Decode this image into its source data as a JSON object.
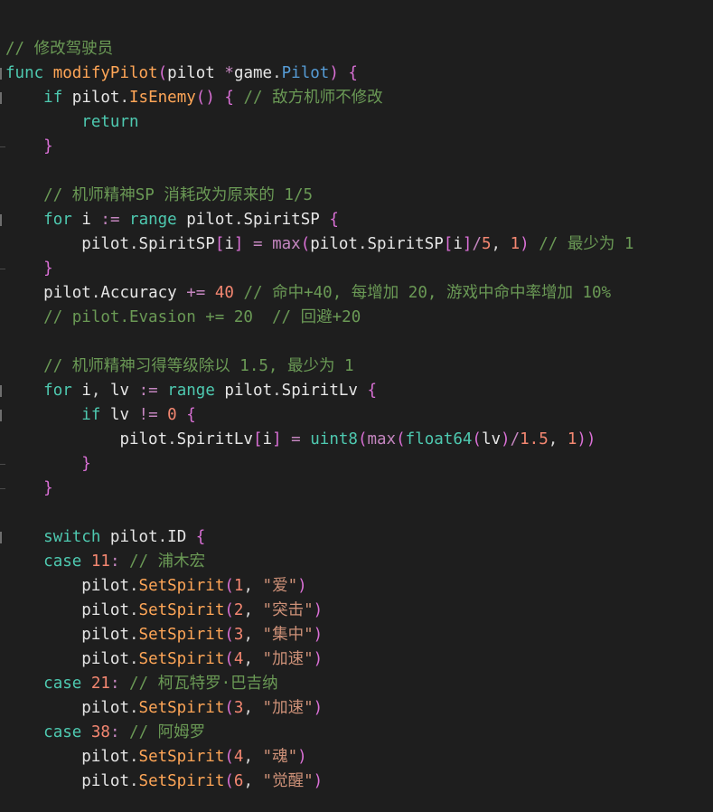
{
  "colors": {
    "background": "#1e1e1e",
    "comment": "#6a9955",
    "keyword": "#4ec9b0",
    "function_name": "#dcdcaa",
    "method": "#ffa657",
    "type": "#569cd6",
    "number": "#f48771",
    "string": "#ce9178",
    "operator": "#c586c0",
    "identifier": "#e6e6e6",
    "bracket": "#da70d6"
  },
  "code_lines": [
    {
      "fold": false,
      "tokens": [
        {
          "t": "comment",
          "v": "// 修改驾驶员"
        }
      ]
    },
    {
      "fold": true,
      "tokens": [
        {
          "t": "keyword",
          "v": "func"
        },
        {
          "t": "plain",
          "v": " "
        },
        {
          "t": "fn-orange",
          "v": "modifyPilot"
        },
        {
          "t": "paren",
          "v": "("
        },
        {
          "t": "ident",
          "v": "pilot"
        },
        {
          "t": "plain",
          "v": " "
        },
        {
          "t": "op",
          "v": "*"
        },
        {
          "t": "ident",
          "v": "game"
        },
        {
          "t": "dot",
          "v": "."
        },
        {
          "t": "type",
          "v": "Pilot"
        },
        {
          "t": "paren",
          "v": ")"
        },
        {
          "t": "plain",
          "v": " "
        },
        {
          "t": "paren",
          "v": "{"
        }
      ]
    },
    {
      "fold": true,
      "tokens": [
        {
          "t": "plain",
          "v": "    "
        },
        {
          "t": "keyword",
          "v": "if"
        },
        {
          "t": "plain",
          "v": " "
        },
        {
          "t": "ident",
          "v": "pilot"
        },
        {
          "t": "dot",
          "v": "."
        },
        {
          "t": "method",
          "v": "IsEnemy"
        },
        {
          "t": "paren",
          "v": "()"
        },
        {
          "t": "plain",
          "v": " "
        },
        {
          "t": "paren",
          "v": "{"
        },
        {
          "t": "plain",
          "v": " "
        },
        {
          "t": "comment",
          "v": "// 敌方机师不修改"
        }
      ]
    },
    {
      "fold": false,
      "tokens": [
        {
          "t": "plain",
          "v": "        "
        },
        {
          "t": "keyword",
          "v": "return"
        }
      ]
    },
    {
      "fold": false,
      "guide": true,
      "tokens": [
        {
          "t": "plain",
          "v": "    "
        },
        {
          "t": "paren",
          "v": "}"
        }
      ]
    },
    {
      "fold": false,
      "tokens": []
    },
    {
      "fold": false,
      "tokens": [
        {
          "t": "plain",
          "v": "    "
        },
        {
          "t": "comment",
          "v": "// 机师精神SP 消耗改为原来的 1/5"
        }
      ]
    },
    {
      "fold": true,
      "tokens": [
        {
          "t": "plain",
          "v": "    "
        },
        {
          "t": "keyword",
          "v": "for"
        },
        {
          "t": "plain",
          "v": " "
        },
        {
          "t": "ident",
          "v": "i"
        },
        {
          "t": "plain",
          "v": " "
        },
        {
          "t": "op",
          "v": ":="
        },
        {
          "t": "plain",
          "v": " "
        },
        {
          "t": "keyword",
          "v": "range"
        },
        {
          "t": "plain",
          "v": " "
        },
        {
          "t": "ident",
          "v": "pilot"
        },
        {
          "t": "dot",
          "v": "."
        },
        {
          "t": "ident",
          "v": "SpiritSP"
        },
        {
          "t": "plain",
          "v": " "
        },
        {
          "t": "paren",
          "v": "{"
        }
      ]
    },
    {
      "fold": false,
      "tokens": [
        {
          "t": "plain",
          "v": "        "
        },
        {
          "t": "ident",
          "v": "pilot"
        },
        {
          "t": "dot",
          "v": "."
        },
        {
          "t": "ident",
          "v": "SpiritSP"
        },
        {
          "t": "paren",
          "v": "["
        },
        {
          "t": "ident",
          "v": "i"
        },
        {
          "t": "paren",
          "v": "]"
        },
        {
          "t": "plain",
          "v": " "
        },
        {
          "t": "op",
          "v": "="
        },
        {
          "t": "plain",
          "v": " "
        },
        {
          "t": "builtin",
          "v": "max"
        },
        {
          "t": "paren",
          "v": "("
        },
        {
          "t": "ident",
          "v": "pilot"
        },
        {
          "t": "dot",
          "v": "."
        },
        {
          "t": "ident",
          "v": "SpiritSP"
        },
        {
          "t": "paren",
          "v": "["
        },
        {
          "t": "ident",
          "v": "i"
        },
        {
          "t": "paren",
          "v": "]"
        },
        {
          "t": "op",
          "v": "/"
        },
        {
          "t": "number",
          "v": "5"
        },
        {
          "t": "plain",
          "v": ", "
        },
        {
          "t": "number",
          "v": "1"
        },
        {
          "t": "paren",
          "v": ")"
        },
        {
          "t": "plain",
          "v": " "
        },
        {
          "t": "comment",
          "v": "// 最少为 1"
        }
      ]
    },
    {
      "fold": false,
      "guide": true,
      "tokens": [
        {
          "t": "plain",
          "v": "    "
        },
        {
          "t": "paren",
          "v": "}"
        }
      ]
    },
    {
      "fold": false,
      "tokens": [
        {
          "t": "plain",
          "v": "    "
        },
        {
          "t": "ident",
          "v": "pilot"
        },
        {
          "t": "dot",
          "v": "."
        },
        {
          "t": "ident",
          "v": "Accuracy"
        },
        {
          "t": "plain",
          "v": " "
        },
        {
          "t": "op",
          "v": "+="
        },
        {
          "t": "plain",
          "v": " "
        },
        {
          "t": "number",
          "v": "40"
        },
        {
          "t": "plain",
          "v": " "
        },
        {
          "t": "comment",
          "v": "// 命中+40, 每增加 20, 游戏中命中率增加 10%"
        }
      ]
    },
    {
      "fold": false,
      "tokens": [
        {
          "t": "plain",
          "v": "    "
        },
        {
          "t": "comment",
          "v": "// pilot.Evasion += 20  // 回避+20"
        }
      ]
    },
    {
      "fold": false,
      "tokens": []
    },
    {
      "fold": false,
      "tokens": [
        {
          "t": "plain",
          "v": "    "
        },
        {
          "t": "comment",
          "v": "// 机师精神习得等级除以 1.5, 最少为 1"
        }
      ]
    },
    {
      "fold": true,
      "tokens": [
        {
          "t": "plain",
          "v": "    "
        },
        {
          "t": "keyword",
          "v": "for"
        },
        {
          "t": "plain",
          "v": " "
        },
        {
          "t": "ident",
          "v": "i"
        },
        {
          "t": "plain",
          "v": ", "
        },
        {
          "t": "ident",
          "v": "lv"
        },
        {
          "t": "plain",
          "v": " "
        },
        {
          "t": "op",
          "v": ":="
        },
        {
          "t": "plain",
          "v": " "
        },
        {
          "t": "keyword",
          "v": "range"
        },
        {
          "t": "plain",
          "v": " "
        },
        {
          "t": "ident",
          "v": "pilot"
        },
        {
          "t": "dot",
          "v": "."
        },
        {
          "t": "ident",
          "v": "SpiritLv"
        },
        {
          "t": "plain",
          "v": " "
        },
        {
          "t": "paren",
          "v": "{"
        }
      ]
    },
    {
      "fold": true,
      "tokens": [
        {
          "t": "plain",
          "v": "        "
        },
        {
          "t": "keyword",
          "v": "if"
        },
        {
          "t": "plain",
          "v": " "
        },
        {
          "t": "ident",
          "v": "lv"
        },
        {
          "t": "plain",
          "v": " "
        },
        {
          "t": "op",
          "v": "!="
        },
        {
          "t": "plain",
          "v": " "
        },
        {
          "t": "number",
          "v": "0"
        },
        {
          "t": "plain",
          "v": " "
        },
        {
          "t": "paren",
          "v": "{"
        }
      ]
    },
    {
      "fold": false,
      "tokens": [
        {
          "t": "plain",
          "v": "            "
        },
        {
          "t": "ident",
          "v": "pilot"
        },
        {
          "t": "dot",
          "v": "."
        },
        {
          "t": "ident",
          "v": "SpiritLv"
        },
        {
          "t": "paren",
          "v": "["
        },
        {
          "t": "ident",
          "v": "i"
        },
        {
          "t": "paren",
          "v": "]"
        },
        {
          "t": "plain",
          "v": " "
        },
        {
          "t": "op",
          "v": "="
        },
        {
          "t": "plain",
          "v": " "
        },
        {
          "t": "keyword",
          "v": "uint8"
        },
        {
          "t": "paren",
          "v": "("
        },
        {
          "t": "builtin",
          "v": "max"
        },
        {
          "t": "paren",
          "v": "("
        },
        {
          "t": "keyword",
          "v": "float64"
        },
        {
          "t": "paren",
          "v": "("
        },
        {
          "t": "ident",
          "v": "lv"
        },
        {
          "t": "paren",
          "v": ")"
        },
        {
          "t": "op",
          "v": "/"
        },
        {
          "t": "number",
          "v": "1.5"
        },
        {
          "t": "plain",
          "v": ", "
        },
        {
          "t": "number",
          "v": "1"
        },
        {
          "t": "paren",
          "v": "))"
        }
      ]
    },
    {
      "fold": false,
      "guide": true,
      "tokens": [
        {
          "t": "plain",
          "v": "        "
        },
        {
          "t": "paren",
          "v": "}"
        }
      ]
    },
    {
      "fold": false,
      "guide": true,
      "tokens": [
        {
          "t": "plain",
          "v": "    "
        },
        {
          "t": "paren",
          "v": "}"
        }
      ]
    },
    {
      "fold": false,
      "tokens": []
    },
    {
      "fold": true,
      "tokens": [
        {
          "t": "plain",
          "v": "    "
        },
        {
          "t": "keyword",
          "v": "switch"
        },
        {
          "t": "plain",
          "v": " "
        },
        {
          "t": "ident",
          "v": "pilot"
        },
        {
          "t": "dot",
          "v": "."
        },
        {
          "t": "ident",
          "v": "ID"
        },
        {
          "t": "plain",
          "v": " "
        },
        {
          "t": "paren",
          "v": "{"
        }
      ]
    },
    {
      "fold": false,
      "tokens": [
        {
          "t": "plain",
          "v": "    "
        },
        {
          "t": "keyword",
          "v": "case"
        },
        {
          "t": "plain",
          "v": " "
        },
        {
          "t": "number",
          "v": "11"
        },
        {
          "t": "op",
          "v": ":"
        },
        {
          "t": "plain",
          "v": " "
        },
        {
          "t": "comment",
          "v": "// 浦木宏"
        }
      ]
    },
    {
      "fold": false,
      "tokens": [
        {
          "t": "plain",
          "v": "        "
        },
        {
          "t": "ident",
          "v": "pilot"
        },
        {
          "t": "dot",
          "v": "."
        },
        {
          "t": "method",
          "v": "SetSpirit"
        },
        {
          "t": "paren",
          "v": "("
        },
        {
          "t": "number",
          "v": "1"
        },
        {
          "t": "plain",
          "v": ", "
        },
        {
          "t": "string",
          "v": "\"爱\""
        },
        {
          "t": "paren",
          "v": ")"
        }
      ]
    },
    {
      "fold": false,
      "tokens": [
        {
          "t": "plain",
          "v": "        "
        },
        {
          "t": "ident",
          "v": "pilot"
        },
        {
          "t": "dot",
          "v": "."
        },
        {
          "t": "method",
          "v": "SetSpirit"
        },
        {
          "t": "paren",
          "v": "("
        },
        {
          "t": "number",
          "v": "2"
        },
        {
          "t": "plain",
          "v": ", "
        },
        {
          "t": "string",
          "v": "\"突击\""
        },
        {
          "t": "paren",
          "v": ")"
        }
      ]
    },
    {
      "fold": false,
      "tokens": [
        {
          "t": "plain",
          "v": "        "
        },
        {
          "t": "ident",
          "v": "pilot"
        },
        {
          "t": "dot",
          "v": "."
        },
        {
          "t": "method",
          "v": "SetSpirit"
        },
        {
          "t": "paren",
          "v": "("
        },
        {
          "t": "number",
          "v": "3"
        },
        {
          "t": "plain",
          "v": ", "
        },
        {
          "t": "string",
          "v": "\"集中\""
        },
        {
          "t": "paren",
          "v": ")"
        }
      ]
    },
    {
      "fold": false,
      "tokens": [
        {
          "t": "plain",
          "v": "        "
        },
        {
          "t": "ident",
          "v": "pilot"
        },
        {
          "t": "dot",
          "v": "."
        },
        {
          "t": "method",
          "v": "SetSpirit"
        },
        {
          "t": "paren",
          "v": "("
        },
        {
          "t": "number",
          "v": "4"
        },
        {
          "t": "plain",
          "v": ", "
        },
        {
          "t": "string",
          "v": "\"加速\""
        },
        {
          "t": "paren",
          "v": ")"
        }
      ]
    },
    {
      "fold": false,
      "tokens": [
        {
          "t": "plain",
          "v": "    "
        },
        {
          "t": "keyword",
          "v": "case"
        },
        {
          "t": "plain",
          "v": " "
        },
        {
          "t": "number",
          "v": "21"
        },
        {
          "t": "op",
          "v": ":"
        },
        {
          "t": "plain",
          "v": " "
        },
        {
          "t": "comment",
          "v": "// 柯瓦特罗·巴吉纳"
        }
      ]
    },
    {
      "fold": false,
      "tokens": [
        {
          "t": "plain",
          "v": "        "
        },
        {
          "t": "ident",
          "v": "pilot"
        },
        {
          "t": "dot",
          "v": "."
        },
        {
          "t": "method",
          "v": "SetSpirit"
        },
        {
          "t": "paren",
          "v": "("
        },
        {
          "t": "number",
          "v": "3"
        },
        {
          "t": "plain",
          "v": ", "
        },
        {
          "t": "string",
          "v": "\"加速\""
        },
        {
          "t": "paren",
          "v": ")"
        }
      ]
    },
    {
      "fold": false,
      "tokens": [
        {
          "t": "plain",
          "v": "    "
        },
        {
          "t": "keyword",
          "v": "case"
        },
        {
          "t": "plain",
          "v": " "
        },
        {
          "t": "number",
          "v": "38"
        },
        {
          "t": "op",
          "v": ":"
        },
        {
          "t": "plain",
          "v": " "
        },
        {
          "t": "comment",
          "v": "// 阿姆罗"
        }
      ]
    },
    {
      "fold": false,
      "tokens": [
        {
          "t": "plain",
          "v": "        "
        },
        {
          "t": "ident",
          "v": "pilot"
        },
        {
          "t": "dot",
          "v": "."
        },
        {
          "t": "method",
          "v": "SetSpirit"
        },
        {
          "t": "paren",
          "v": "("
        },
        {
          "t": "number",
          "v": "4"
        },
        {
          "t": "plain",
          "v": ", "
        },
        {
          "t": "string",
          "v": "\"魂\""
        },
        {
          "t": "paren",
          "v": ")"
        }
      ]
    },
    {
      "fold": false,
      "tokens": [
        {
          "t": "plain",
          "v": "        "
        },
        {
          "t": "ident",
          "v": "pilot"
        },
        {
          "t": "dot",
          "v": "."
        },
        {
          "t": "method",
          "v": "SetSpirit"
        },
        {
          "t": "paren",
          "v": "("
        },
        {
          "t": "number",
          "v": "6"
        },
        {
          "t": "plain",
          "v": ", "
        },
        {
          "t": "string",
          "v": "\"觉醒\""
        },
        {
          "t": "paren",
          "v": ")"
        }
      ]
    }
  ]
}
